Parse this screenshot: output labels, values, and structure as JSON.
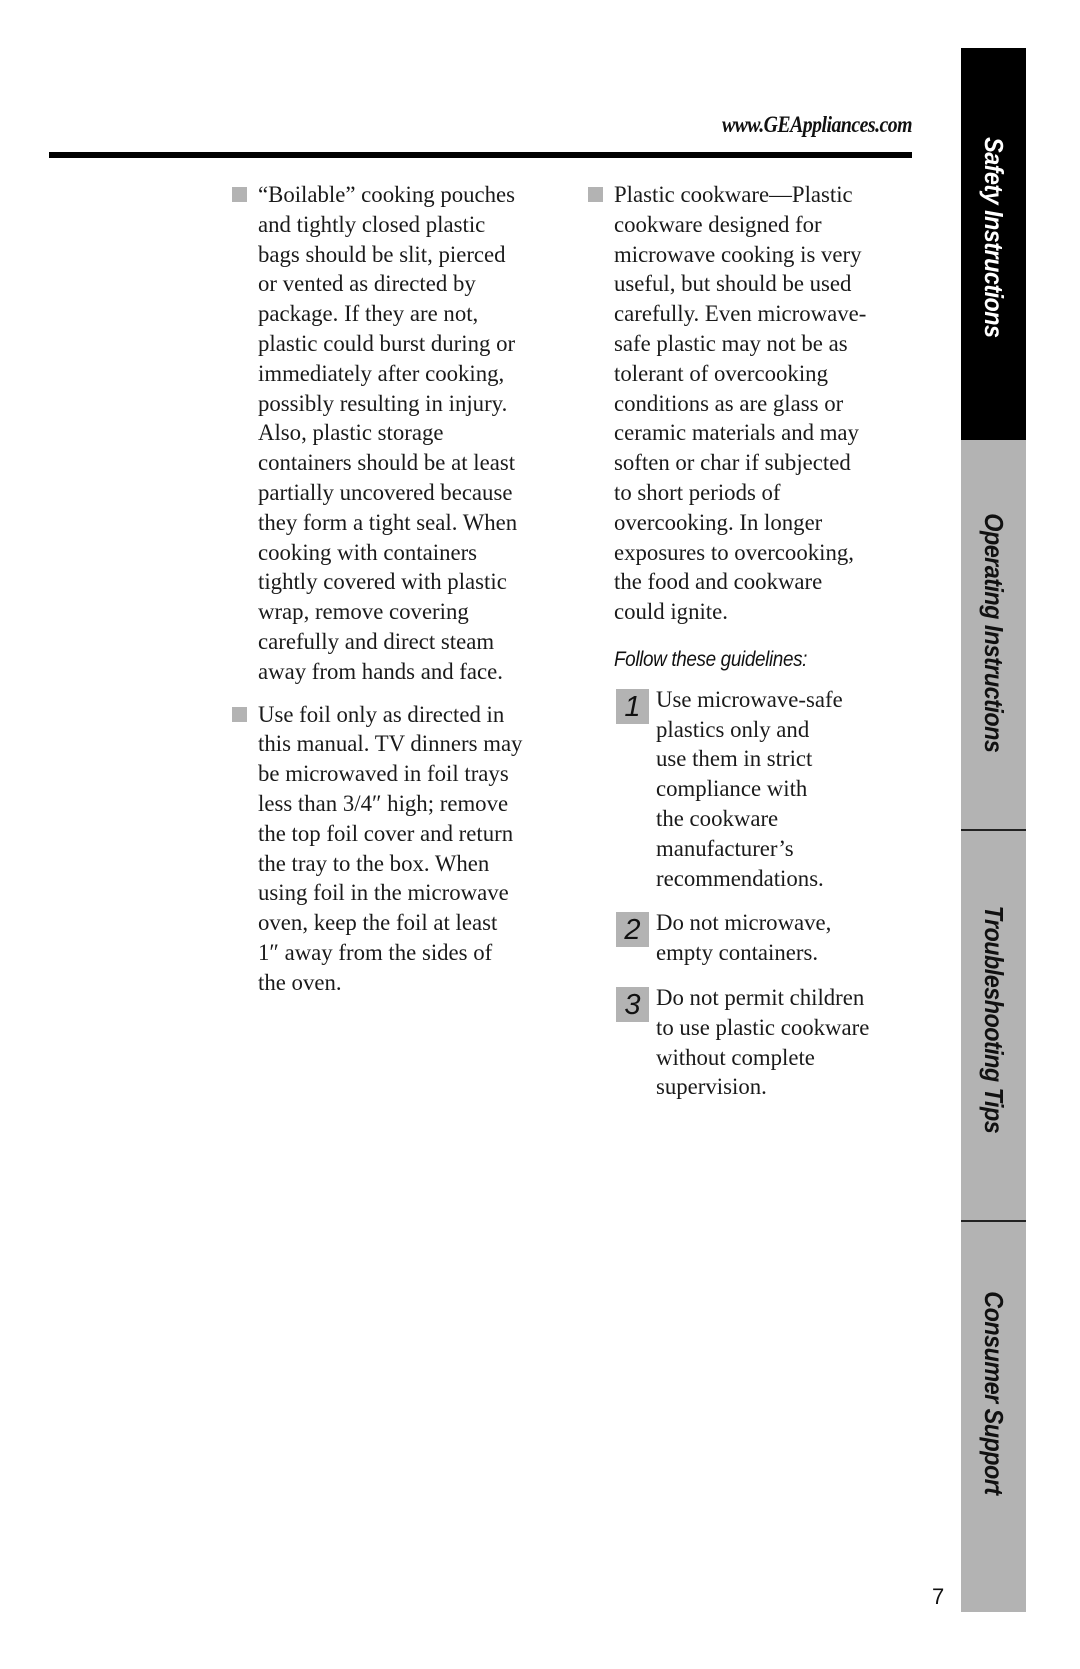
{
  "header": {
    "url": "www.GEAppliances.com"
  },
  "left_column": {
    "items": [
      {
        "lines": [
          "“Boilable” cooking pouches",
          "and tightly closed plastic",
          "bags should be slit, pierced",
          "or vented as directed by",
          "package. If they are not,",
          "plastic could burst during or",
          "immediately after cooking,",
          "possibly resulting in injury.",
          "Also, plastic storage",
          "containers should be at least",
          "partially uncovered because",
          "they form a tight seal. When",
          "cooking with containers",
          "tightly covered with plastic",
          "wrap, remove covering",
          "carefully and direct steam",
          "away from hands and face."
        ]
      },
      {
        "lines": [
          "Use foil only as directed in",
          "this manual. TV dinners may",
          "be microwaved in foil trays",
          "less than 3/4″ high; remove",
          "the top foil cover and return",
          "the tray to the box. When",
          "using foil in the microwave",
          "oven, keep the foil at least",
          "1″ away from the sides of",
          "the oven."
        ]
      }
    ]
  },
  "right_column": {
    "items": [
      {
        "lines": [
          "Plastic cookware—Plastic",
          "cookware designed for",
          "microwave cooking is very",
          "useful, but should be used",
          "carefully. Even microwave-",
          "safe plastic may not be as",
          "tolerant of overcooking",
          "conditions as are glass or",
          "ceramic materials and may",
          "soften or char if subjected",
          "to short periods of",
          "overcooking. In longer",
          "exposures to overcooking,",
          "the food and cookware",
          "could ignite."
        ]
      }
    ],
    "guidelines_title": "Follow these guidelines:",
    "steps": [
      {
        "number": "1",
        "lines": [
          "Use microwave-safe",
          "plastics only and",
          "use them in strict",
          "compliance with",
          "the cookware",
          "manufacturer’s",
          "recommendations."
        ]
      },
      {
        "number": "2",
        "lines": [
          "Do not microwave,",
          "empty containers."
        ]
      },
      {
        "number": "3",
        "lines": [
          "Do not permit children",
          "to use plastic cookware",
          "without complete",
          "supervision."
        ]
      }
    ]
  },
  "side_tabs": [
    {
      "label": "Safety Instructions",
      "active": true
    },
    {
      "label": "Operating Instructions",
      "active": false
    },
    {
      "label": "Troubleshooting Tips",
      "active": false
    },
    {
      "label": "Consumer Support",
      "active": false
    }
  ],
  "colors": {
    "active_tab": "#000000",
    "inactive_tab": "#b3b3b3",
    "bullet": "#b3b3b3",
    "rule": "#000000"
  },
  "footer": {
    "page_number": "7"
  }
}
